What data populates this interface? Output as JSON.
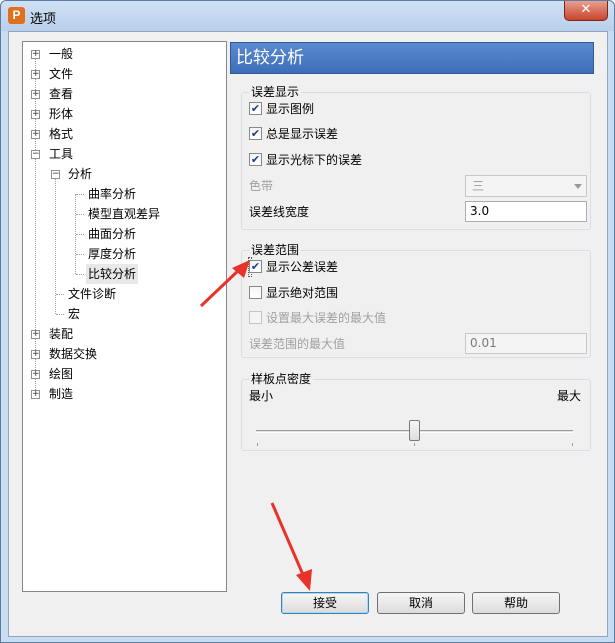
{
  "window": {
    "title": "选项",
    "app_icon": "P",
    "close_label": "✕"
  },
  "tree": {
    "items": [
      {
        "label": "一般",
        "expander": "+"
      },
      {
        "label": "文件",
        "expander": "+"
      },
      {
        "label": "查看",
        "expander": "+"
      },
      {
        "label": "形体",
        "expander": "+"
      },
      {
        "label": "格式",
        "expander": "+"
      },
      {
        "label": "工具",
        "expander": "−"
      },
      {
        "label": "分析",
        "expander": "−"
      },
      {
        "label": "曲率分析"
      },
      {
        "label": "模型直观差异"
      },
      {
        "label": "曲面分析"
      },
      {
        "label": "厚度分析"
      },
      {
        "label": "比较分析",
        "selected": true
      },
      {
        "label": "文件诊断"
      },
      {
        "label": "宏"
      },
      {
        "label": "装配",
        "expander": "+"
      },
      {
        "label": "数据交换",
        "expander": "+"
      },
      {
        "label": "绘图",
        "expander": "+"
      },
      {
        "label": "制造",
        "expander": "+"
      }
    ]
  },
  "page": {
    "header": "比较分析",
    "error_display": {
      "title": "误差显示",
      "show_legend": {
        "label": "显示图例",
        "checked": "✔"
      },
      "always_show_error": {
        "label": "总是显示误差",
        "checked": "✔"
      },
      "show_error_under_cursor": {
        "label": "显示光标下的误差",
        "checked": "✔"
      },
      "color_band_label": "色带",
      "color_band_value": "三",
      "error_line_width_label": "误差线宽度",
      "error_line_width_value": "3.0"
    },
    "error_range": {
      "title": "误差范围",
      "show_tolerance": {
        "label": "显示公差误差",
        "checked": "✔"
      },
      "show_absolute_range": {
        "label": "显示绝对范围",
        "checked": ""
      },
      "set_max_error": {
        "label": "设置最大误差的最大值",
        "checked": ""
      },
      "max_range_label": "误差范围的最大值",
      "max_range_value": "0.01"
    },
    "sample_density": {
      "title": "样板点密度",
      "min_label": "最小",
      "max_label": "最大",
      "level": 0.5
    }
  },
  "buttons": {
    "accept": "接受",
    "cancel": "取消",
    "help": "帮助"
  }
}
